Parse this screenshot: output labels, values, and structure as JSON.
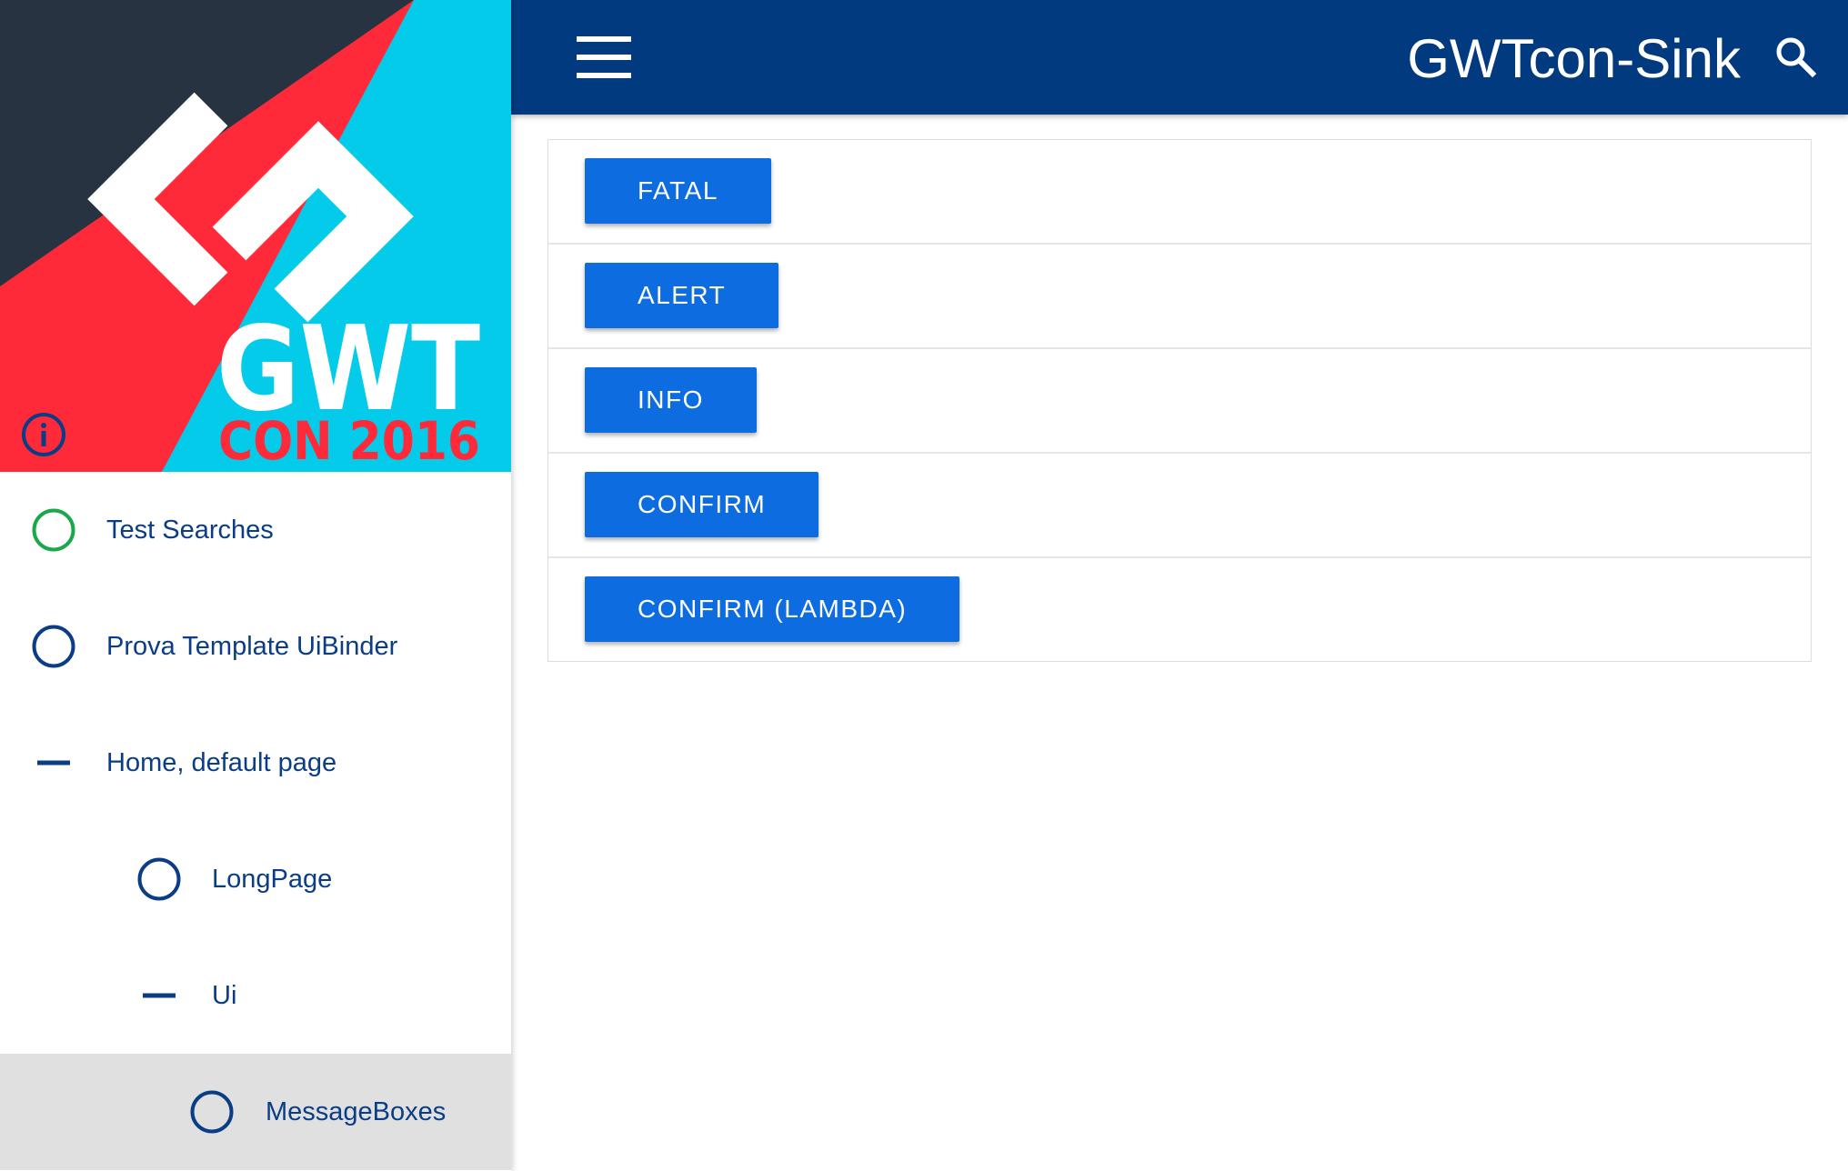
{
  "app": {
    "title": "GWTcon-Sink"
  },
  "header": {
    "menu_icon": "hamburger-menu-icon",
    "search_icon": "search-icon",
    "background_color": "#023a80"
  },
  "banner": {
    "logo_text_top": "GWT",
    "logo_text_bottom": "CON 2016",
    "info_icon": "info-circle-icon",
    "colors": {
      "dark": "#283341",
      "red": "#fe2a3a",
      "cyan": "#05cbea"
    }
  },
  "sidebar": {
    "items": [
      {
        "label": "Test Searches",
        "icon": "circle-outline-icon",
        "icon_color": "#1aa84a",
        "level": 0,
        "active": false
      },
      {
        "label": "Prova Template UiBinder",
        "icon": "circle-outline-icon",
        "icon_color": "#0a3d85",
        "level": 0,
        "active": false
      },
      {
        "label": "Home, default page",
        "icon": "minus-icon",
        "icon_color": "#0a3d85",
        "level": 0,
        "active": false
      },
      {
        "label": "LongPage",
        "icon": "circle-outline-icon",
        "icon_color": "#0a3d85",
        "level": 1,
        "active": false
      },
      {
        "label": "Ui",
        "icon": "minus-icon",
        "icon_color": "#0a3d85",
        "level": 1,
        "active": false
      },
      {
        "label": "MessageBoxes",
        "icon": "circle-outline-icon",
        "icon_color": "#0a3d85",
        "level": 2,
        "active": true
      }
    ]
  },
  "main": {
    "buttons": [
      {
        "label": "FATAL"
      },
      {
        "label": "ALERT"
      },
      {
        "label": "INFO"
      },
      {
        "label": "CONFIRM"
      },
      {
        "label": "CONFIRM (LAMBDA)"
      }
    ],
    "button_color": "#0d6ce0"
  }
}
